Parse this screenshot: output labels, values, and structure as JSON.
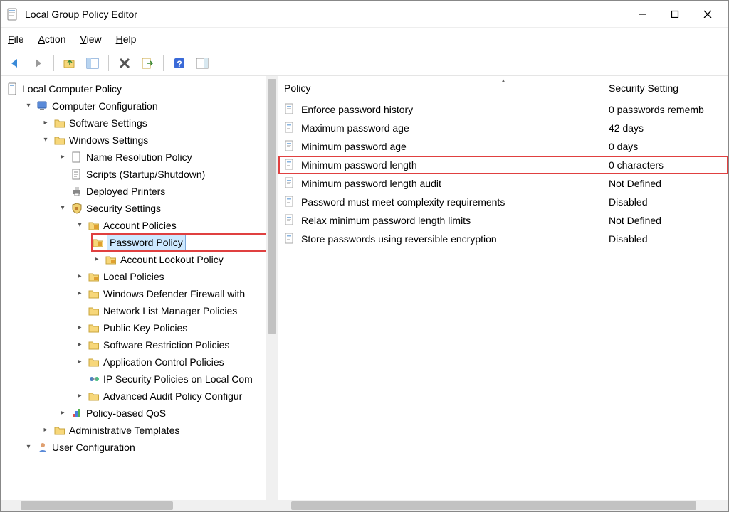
{
  "window": {
    "title": "Local Group Policy Editor"
  },
  "menu": {
    "file": "File",
    "action": "Action",
    "view": "View",
    "help": "Help"
  },
  "tree": {
    "root": "Local Computer Policy",
    "comp_cfg": "Computer Configuration",
    "software_settings": "Software Settings",
    "windows_settings": "Windows Settings",
    "name_res": "Name Resolution Policy",
    "scripts": "Scripts (Startup/Shutdown)",
    "deployed_printers": "Deployed Printers",
    "security_settings": "Security Settings",
    "account_policies": "Account Policies",
    "password_policy": "Password Policy",
    "account_lockout": "Account Lockout Policy",
    "local_policies": "Local Policies",
    "firewall": "Windows Defender Firewall with",
    "nlm": "Network List Manager Policies",
    "pk": "Public Key Policies",
    "srp": "Software Restriction Policies",
    "acp": "Application Control Policies",
    "ipsec": "IP Security Policies on Local Com",
    "audit": "Advanced Audit Policy Configur",
    "qos": "Policy-based QoS",
    "admin_tmpl": "Administrative Templates",
    "user_cfg": "User Configuration"
  },
  "columns": {
    "policy": "Policy",
    "setting": "Security Setting"
  },
  "policies": [
    {
      "name": "Enforce password history",
      "setting": "0 passwords rememb",
      "hl": false
    },
    {
      "name": "Maximum password age",
      "setting": "42 days",
      "hl": false
    },
    {
      "name": "Minimum password age",
      "setting": "0 days",
      "hl": false
    },
    {
      "name": "Minimum password length",
      "setting": "0 characters",
      "hl": true
    },
    {
      "name": "Minimum password length audit",
      "setting": "Not Defined",
      "hl": false
    },
    {
      "name": "Password must meet complexity requirements",
      "setting": "Disabled",
      "hl": false
    },
    {
      "name": "Relax minimum password length limits",
      "setting": "Not Defined",
      "hl": false
    },
    {
      "name": "Store passwords using reversible encryption",
      "setting": "Disabled",
      "hl": false
    }
  ]
}
